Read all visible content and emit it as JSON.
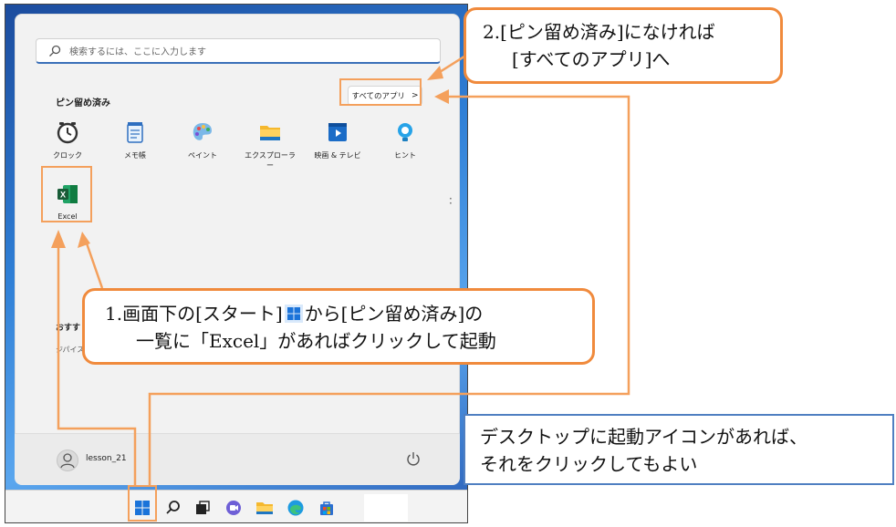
{
  "start_menu": {
    "search_placeholder": "検索するには、ここに入力します",
    "pinned_title": "ピン留め済み",
    "all_apps_label": "すべてのアプリ",
    "all_apps_chevron": ">",
    "apps": [
      {
        "label": "クロック",
        "icon": "clock-icon"
      },
      {
        "label": "メモ帳",
        "icon": "notepad-icon"
      },
      {
        "label": "ペイント",
        "icon": "paint-icon"
      },
      {
        "label": "エクスプローラー",
        "icon": "folder-icon"
      },
      {
        "label": "映画 & テレビ",
        "icon": "movies-tv-icon"
      },
      {
        "label": "ヒント",
        "icon": "tips-icon"
      }
    ],
    "excel_label": "Excel",
    "recommended_title": "おすす",
    "recommended_sub": "ジパイス",
    "user_name": "lesson_21"
  },
  "taskbar": {
    "icons": [
      "start-icon",
      "search-icon",
      "task-view-icon",
      "chat-icon",
      "file-explorer-icon",
      "edge-icon",
      "store-icon"
    ]
  },
  "annotations": {
    "callout1_line1a": "1.画面下の[スタート]",
    "callout1_line1b": "から[ピン留め済み]の",
    "callout1_line2": "一覧に「Excel」があればクリックして起動",
    "callout2_line1": "2.[ピン留め済み]になければ",
    "callout2_line2": "[すべてのアプリ]へ",
    "desktop_note_line1": "デスクトップに起動アイコンがあれば、",
    "desktop_note_line2": "それをクリックしてもよい"
  },
  "colors": {
    "annotation_orange": "#f08a3c",
    "note_border_blue": "#4f7fc1",
    "excel_green": "#1e7145",
    "windows_blue": "#1a73d9"
  }
}
